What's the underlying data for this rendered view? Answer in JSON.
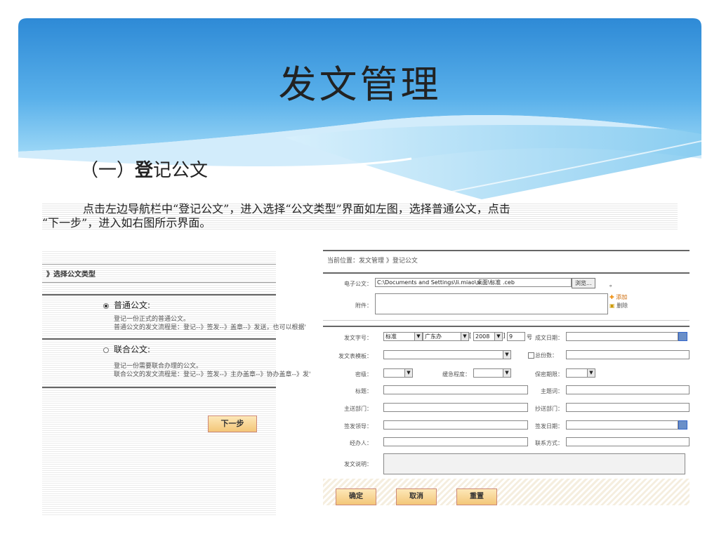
{
  "slide": {
    "title": "发文管理",
    "section_prefix": "（一）",
    "section_bold": "登",
    "section_rest": "记公文",
    "desc_line1": "点击左边导航栏中“登记公文”，进入选择“公文类型”界面如左图，选择普通公文，点击",
    "desc_line2": "“下一步”，进入如右图所示界面。"
  },
  "left_panel": {
    "crumb": "》选择公文类型",
    "option1": {
      "title": "普通公文:",
      "desc1": "登记一份正式的普通公文。",
      "desc2": "普通公文的发文流程是：登记--》签发--》盖章--》发送，也可以根据'"
    },
    "option2": {
      "title": "联合公文:",
      "desc1": "登记一份需要联合办理的公文。",
      "desc2": "联合公文的发文流程是：登记--》签发--》主办盖章--》协办盖章--》发'"
    },
    "selected": "普通公文",
    "next_label": "下一步"
  },
  "right_panel": {
    "crumb": "当前位置：发文管理 》登记公文",
    "e_doc_label": "电子公文：",
    "e_doc_value": "C:\\Documents and Settings\\li.miao\\桌面\\标准 .ceb",
    "browse_label": "浏览...",
    "browse_suffix": "。",
    "attach_label": "附件：",
    "add_label": "添加",
    "delete_label": "删除",
    "doc_no_label": "发文字号：",
    "doc_no_type": "标准",
    "doc_no_org": "广东办",
    "doc_no_year": "2008",
    "doc_no_num": "9",
    "doc_no_suffix": "号",
    "bracket_open": "[",
    "bracket_close": "]",
    "finish_date_label": "成文日期：",
    "template_label": "发文表模板：",
    "total_copies_label": "总份数：",
    "secret_label": "密级：",
    "urgency_label": "缓急程度：",
    "secret_term_label": "保密期限：",
    "subject_label": "标题：",
    "keywords_label": "主题词：",
    "main_dept_label": "主送部门：",
    "cc_dept_label": "抄送部门：",
    "signer_label": "签发领导：",
    "sign_date_label": "签发日期：",
    "handler_label": "经办人：",
    "contact_label": "联系方式：",
    "note_label": "发文说明：",
    "confirm_label": "确定",
    "cancel_label": "取消",
    "reset_label": "重置"
  },
  "colors": {
    "header_blue": "#2e8ad6",
    "header_light": "#6fc1ef",
    "button_orange": "#f3c678"
  }
}
